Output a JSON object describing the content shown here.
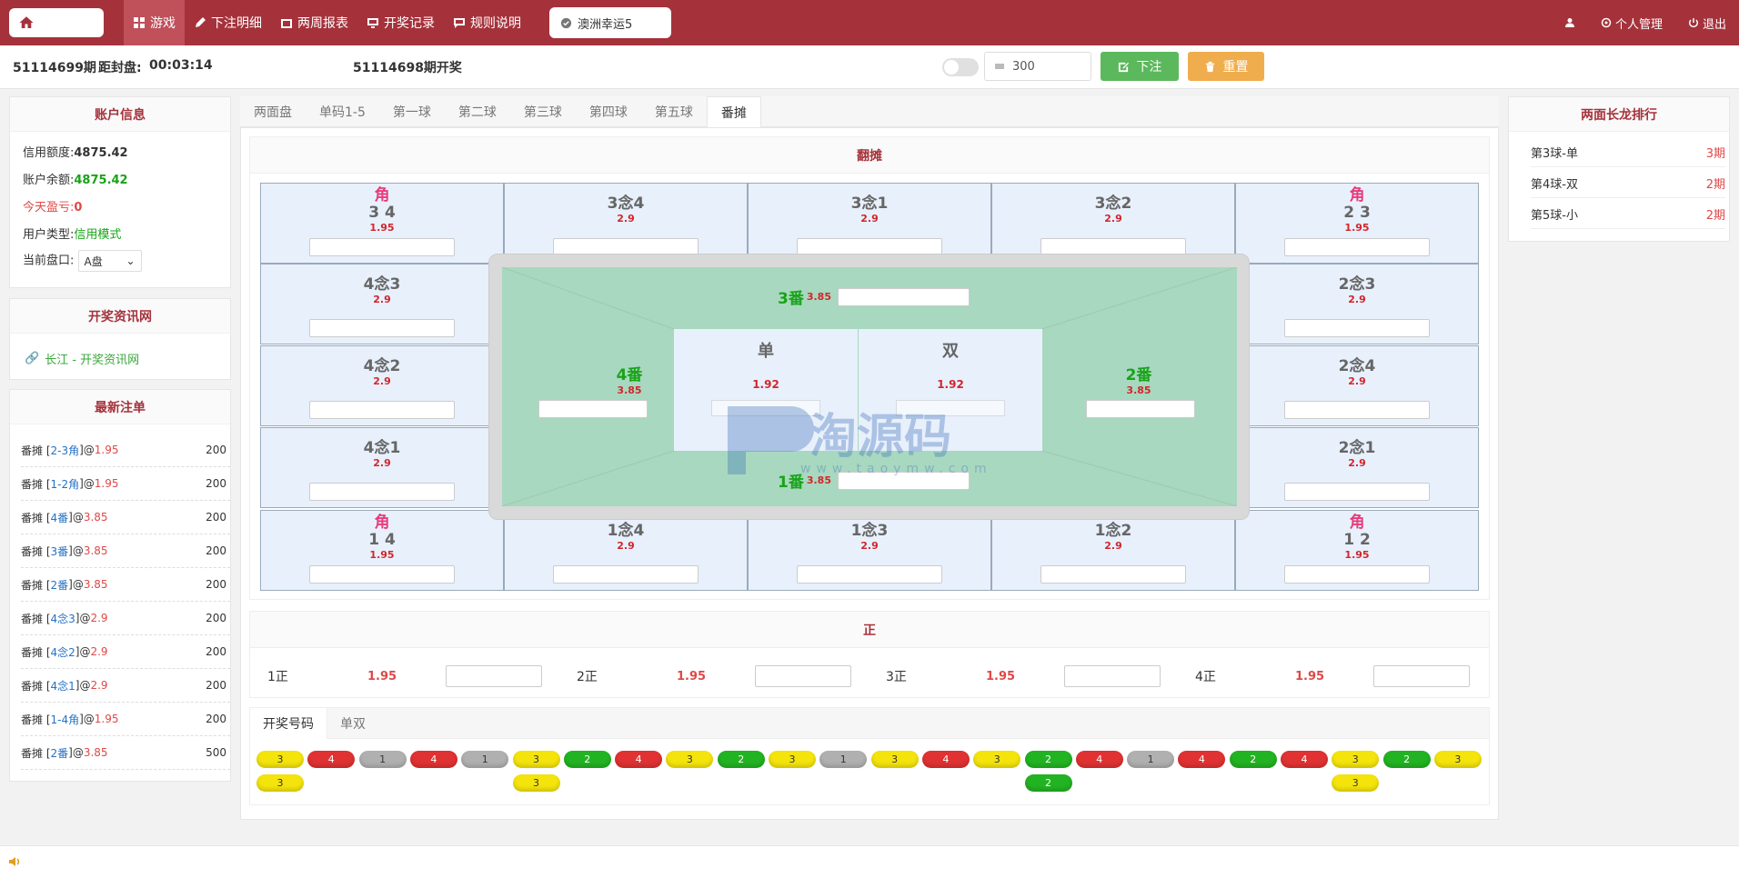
{
  "nav": {
    "items": [
      "游戏",
      "下注明细",
      "两周报表",
      "开奖记录",
      "规则说明"
    ],
    "active_index": 0,
    "lottery_button": "澳洲幸运5",
    "user_menu": "个人管理",
    "logout": "退出"
  },
  "period": {
    "current": "51114699期",
    "close_label": "距封盘:",
    "countdown": "00:03:14",
    "last_draw": "51114698期开奖"
  },
  "bet_controls": {
    "amount": "300",
    "bet_label": "下注",
    "reset_label": "重置"
  },
  "account": {
    "title": "账户信息",
    "credit_label": "信用额度:",
    "credit_value": "4875.42",
    "balance_label": "账户余额:",
    "balance_value": "4875.42",
    "pnl_label": "今天盈亏:",
    "pnl_value": "0",
    "type_label": "用户类型:",
    "type_value": "信用模式",
    "market_label": "当前盘口:",
    "market_value": "A盘"
  },
  "info_site": {
    "title": "开奖资讯网",
    "link": "长江 - 开奖资讯网"
  },
  "latest_bets": {
    "title": "最新注单",
    "rows": [
      {
        "prefix": "番摊 [",
        "item": "2-3角",
        "odds": "1.95",
        "amount": "200"
      },
      {
        "prefix": "番摊 [",
        "item": "1-2角",
        "odds": "1.95",
        "amount": "200"
      },
      {
        "prefix": "番摊 [",
        "item": "4番",
        "odds": "3.85",
        "amount": "200"
      },
      {
        "prefix": "番摊 [",
        "item": "3番",
        "odds": "3.85",
        "amount": "200"
      },
      {
        "prefix": "番摊 [",
        "item": "2番",
        "odds": "3.85",
        "amount": "200"
      },
      {
        "prefix": "番摊 [",
        "item": "4念3",
        "odds": "2.9",
        "amount": "200"
      },
      {
        "prefix": "番摊 [",
        "item": "4念2",
        "odds": "2.9",
        "amount": "200"
      },
      {
        "prefix": "番摊 [",
        "item": "4念1",
        "odds": "2.9",
        "amount": "200"
      },
      {
        "prefix": "番摊 [",
        "item": "1-4角",
        "odds": "1.95",
        "amount": "200"
      },
      {
        "prefix": "番摊 [",
        "item": "2番",
        "odds": "3.85",
        "amount": "500"
      }
    ]
  },
  "game_tabs": [
    "两面盘",
    "单码1-5",
    "第一球",
    "第二球",
    "第三球",
    "第四球",
    "第五球",
    "番摊"
  ],
  "fantan": {
    "title": "翻摊",
    "top_row": [
      {
        "jiao": "角",
        "name": "3 4",
        "odds": "1.95"
      },
      {
        "jiao": "",
        "name": "3念4",
        "odds": "2.9"
      },
      {
        "jiao": "",
        "name": "3念1",
        "odds": "2.9"
      },
      {
        "jiao": "",
        "name": "3念2",
        "odds": "2.9"
      },
      {
        "jiao": "角",
        "name": "2 3",
        "odds": "1.95"
      }
    ],
    "left_col": [
      {
        "name": "4念3",
        "odds": "2.9"
      },
      {
        "name": "4念2",
        "odds": "2.9"
      },
      {
        "name": "4念1",
        "odds": "2.9"
      }
    ],
    "right_col": [
      {
        "name": "2念3",
        "odds": "2.9"
      },
      {
        "name": "2念4",
        "odds": "2.9"
      },
      {
        "name": "2念1",
        "odds": "2.9"
      }
    ],
    "bottom_row": [
      {
        "jiao": "角",
        "name": "1 4",
        "odds": "1.95"
      },
      {
        "jiao": "",
        "name": "1念4",
        "odds": "2.9"
      },
      {
        "jiao": "",
        "name": "1念3",
        "odds": "2.9"
      },
      {
        "jiao": "",
        "name": "1念2",
        "odds": "2.9"
      },
      {
        "jiao": "角",
        "name": "1 2",
        "odds": "1.95"
      }
    ],
    "fan3": {
      "name": "3番",
      "odds": "3.85"
    },
    "fan4": {
      "name": "4番",
      "odds": "3.85"
    },
    "fan2": {
      "name": "2番",
      "odds": "3.85"
    },
    "fan1": {
      "name": "1番",
      "odds": "3.85"
    },
    "odd": {
      "name": "单",
      "odds": "1.92"
    },
    "even": {
      "name": "双",
      "odds": "1.92"
    }
  },
  "zheng": {
    "title": "正",
    "items": [
      {
        "name": "1正",
        "odds": "1.95"
      },
      {
        "name": "2正",
        "odds": "1.95"
      },
      {
        "name": "3正",
        "odds": "1.95"
      },
      {
        "name": "4正",
        "odds": "1.95"
      }
    ]
  },
  "results": {
    "tabs": [
      "开奖号码",
      "单双"
    ],
    "columns": [
      [
        "3",
        "3"
      ],
      [
        "4"
      ],
      [
        "1"
      ],
      [
        "4"
      ],
      [
        "1"
      ],
      [
        "3",
        "3"
      ],
      [
        "2"
      ],
      [
        "4"
      ],
      [
        "3"
      ],
      [
        "2"
      ],
      [
        "3"
      ],
      [
        "1"
      ],
      [
        "3"
      ],
      [
        "4"
      ],
      [
        "3"
      ],
      [
        "2",
        "2"
      ],
      [
        "4"
      ],
      [
        "1"
      ],
      [
        "4"
      ],
      [
        "2"
      ],
      [
        "4"
      ],
      [
        "3",
        "3"
      ],
      [
        "2"
      ],
      [
        "3"
      ]
    ],
    "colors": {
      "1": "#b0b0b0",
      "2": "#22b322",
      "3": "#f4e40c",
      "4": "#e03232"
    }
  },
  "long_dragon": {
    "title": "两面长龙排行",
    "rows": [
      {
        "label": "第3球-单",
        "count": "3期"
      },
      {
        "label": "第4球-双",
        "count": "2期"
      },
      {
        "label": "第5球-小",
        "count": "2期"
      }
    ]
  },
  "watermark": {
    "name": "淘源码",
    "url": "www.taoymw.com"
  }
}
